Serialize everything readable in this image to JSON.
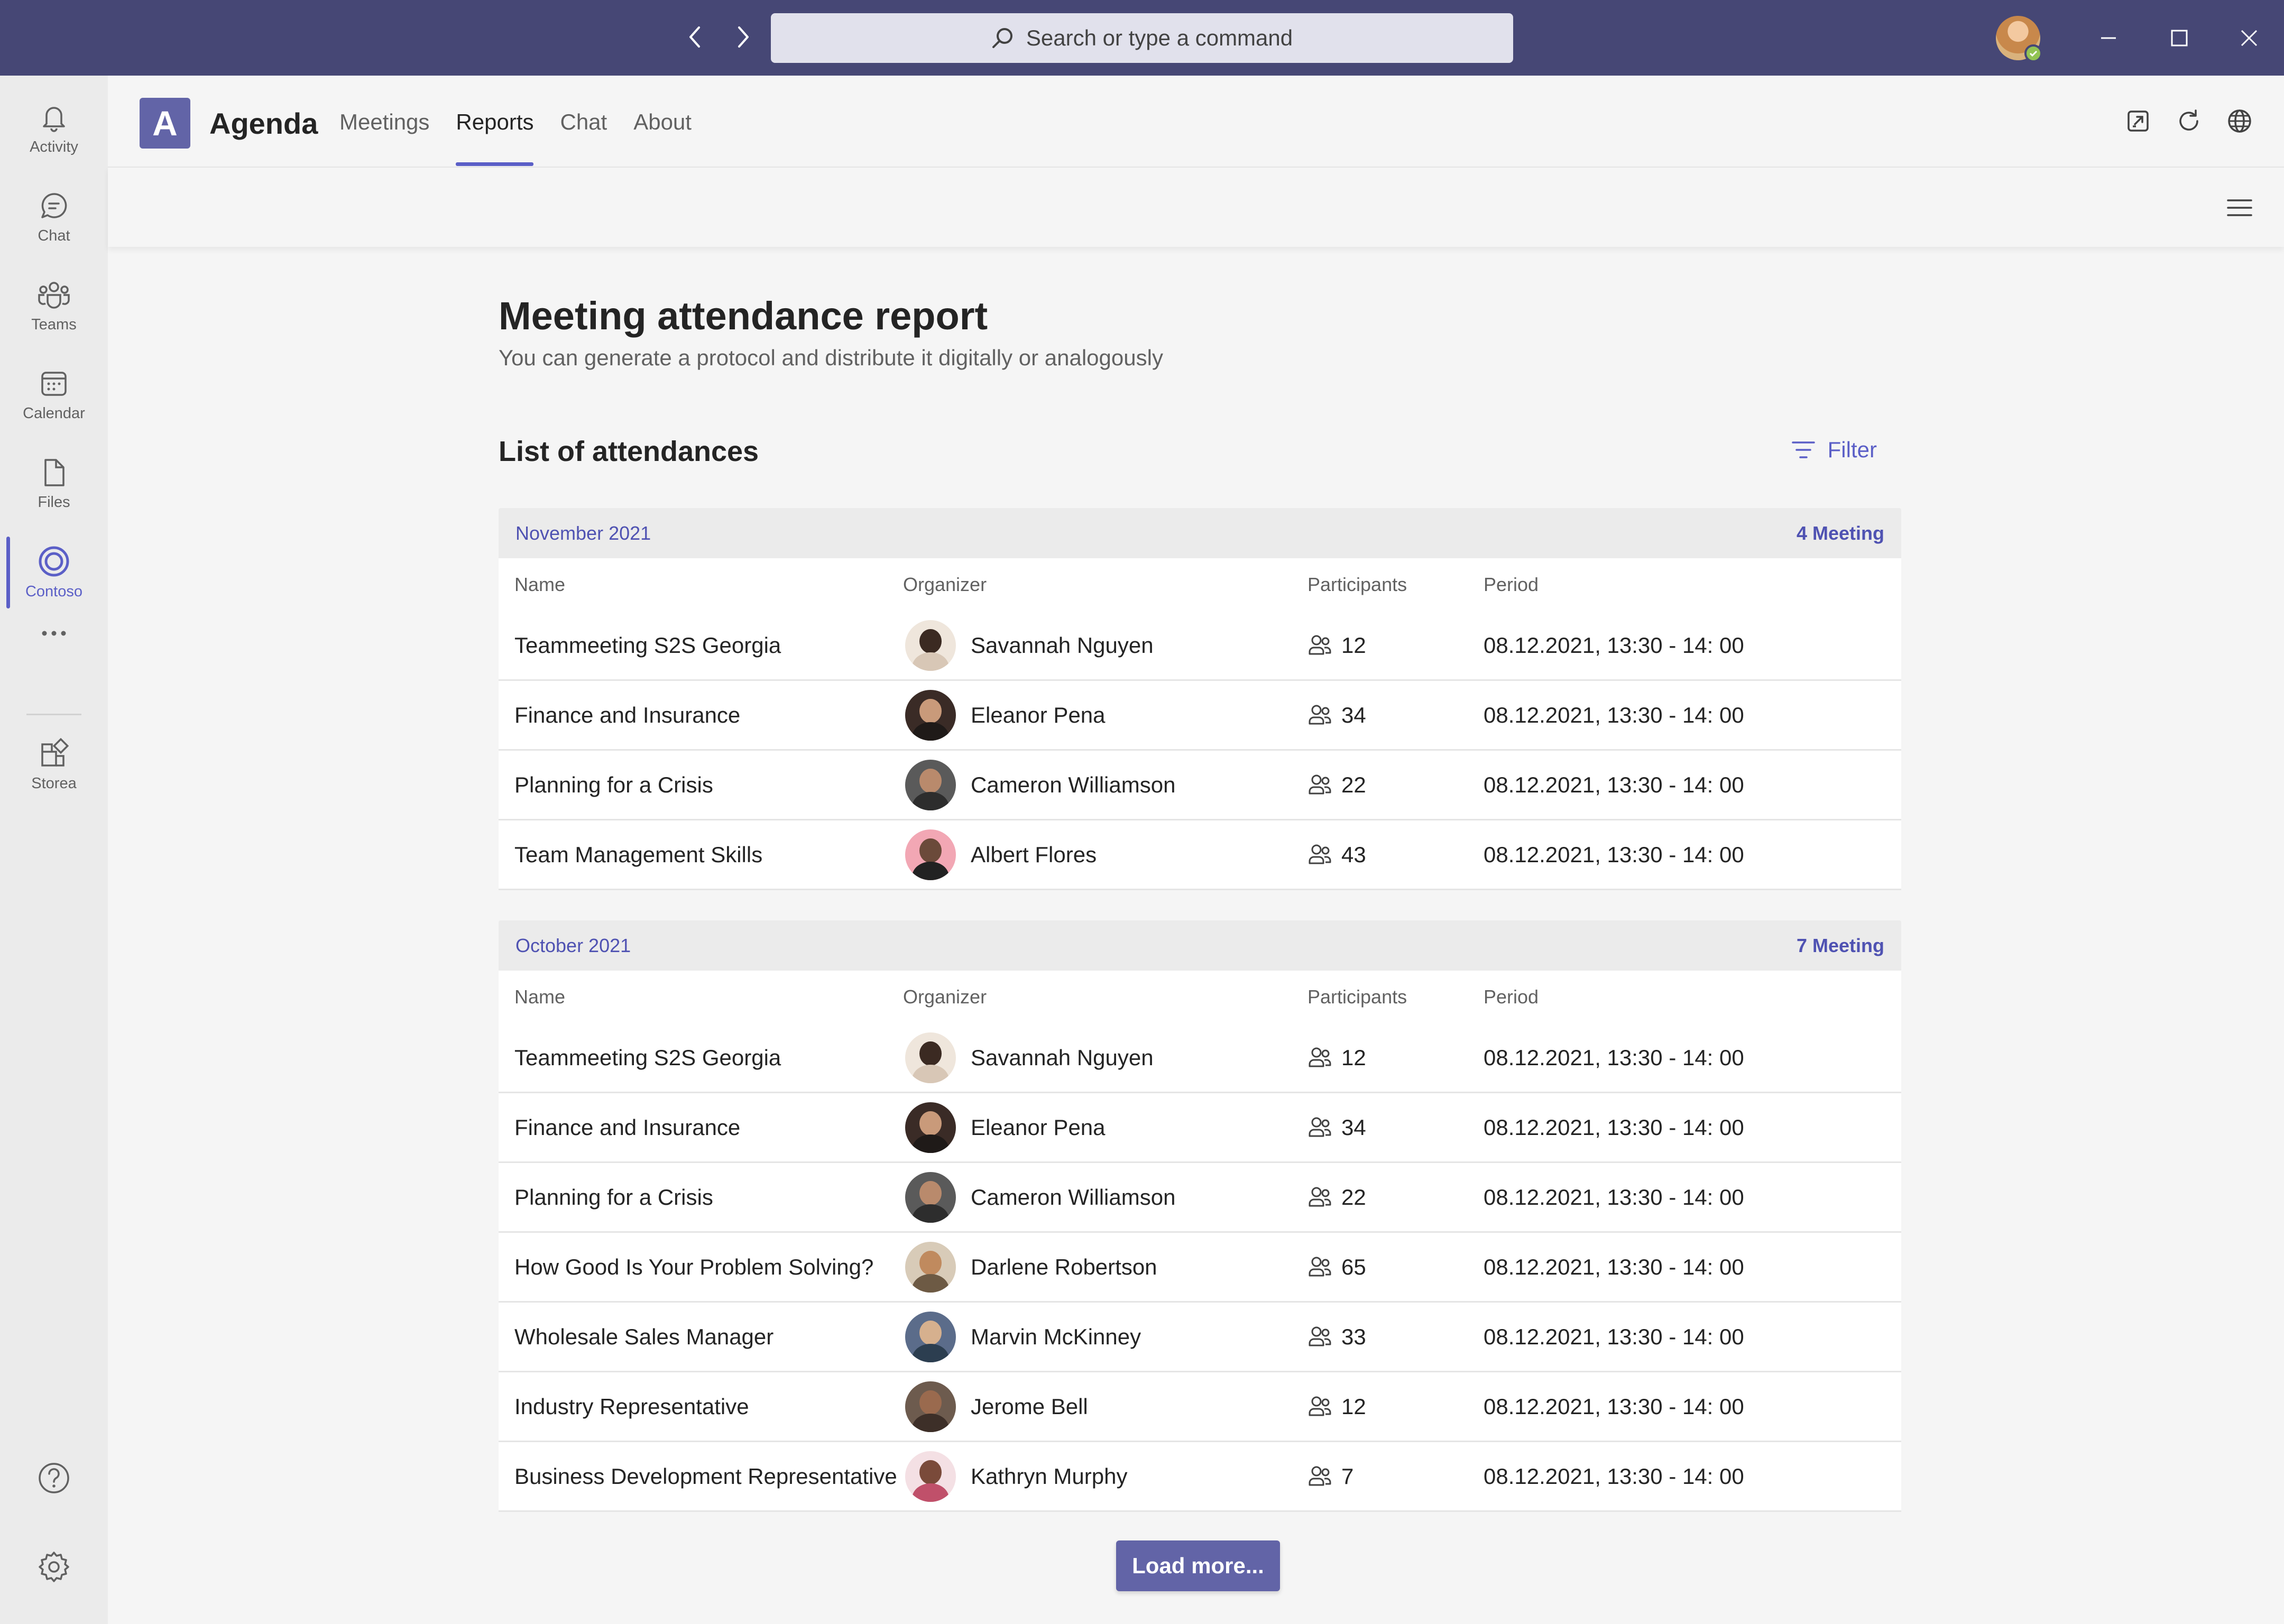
{
  "titlebar": {
    "search_placeholder": "Search or type a command",
    "icons": [
      "back-icon",
      "forward-icon",
      "search-icon",
      "minimize-icon",
      "maximize-icon",
      "close-icon"
    ]
  },
  "rail": {
    "items": [
      {
        "label": "Activity",
        "icon": "bell-icon"
      },
      {
        "label": "Chat",
        "icon": "chat-icon"
      },
      {
        "label": "Teams",
        "icon": "teams-icon"
      },
      {
        "label": "Calendar",
        "icon": "calendar-icon"
      },
      {
        "label": "Files",
        "icon": "file-icon"
      },
      {
        "label": "Contoso",
        "icon": "contoso-icon",
        "active": true
      },
      {
        "label": "Storea",
        "icon": "apps-icon"
      }
    ]
  },
  "app": {
    "logo_letter": "A",
    "name": "Agenda",
    "tabs": [
      {
        "label": "Meetings"
      },
      {
        "label": "Reports",
        "active": true
      },
      {
        "label": "Chat"
      },
      {
        "label": "About"
      }
    ]
  },
  "page": {
    "title": "Meeting attendance report",
    "subtitle": "You can generate a protocol and distribute it digitally or analogously",
    "list_title": "List of attendances",
    "filter_label": "Filter",
    "columns": {
      "name": "Name",
      "organizer": "Organizer",
      "participants": "Participants",
      "period": "Period"
    },
    "load_more": "Load more..."
  },
  "groups": [
    {
      "month": "November 2021",
      "count": "4 Meeting",
      "rows": [
        {
          "name": "Teammeeting S2S Georgia",
          "organizer": "Savannah Nguyen",
          "participants": "12",
          "period": "08.12.2021, 13:30 - 14: 00"
        },
        {
          "name": "Finance and Insurance",
          "organizer": "Eleanor Pena",
          "participants": "34",
          "period": "08.12.2021, 13:30 - 14: 00"
        },
        {
          "name": "Planning for a Crisis",
          "organizer": "Cameron Williamson",
          "participants": "22",
          "period": "08.12.2021, 13:30 - 14: 00"
        },
        {
          "name": "Team Management Skills",
          "organizer": "Albert Flores",
          "participants": "43",
          "period": "08.12.2021, 13:30 - 14: 00"
        }
      ]
    },
    {
      "month": "October 2021",
      "count": "7 Meeting",
      "rows": [
        {
          "name": "Teammeeting S2S Georgia",
          "organizer": "Savannah Nguyen",
          "participants": "12",
          "period": "08.12.2021, 13:30 - 14: 00"
        },
        {
          "name": "Finance and Insurance",
          "organizer": "Eleanor Pena",
          "participants": "34",
          "period": "08.12.2021, 13:30 - 14: 00"
        },
        {
          "name": "Planning for a Crisis",
          "organizer": "Cameron Williamson",
          "participants": "22",
          "period": "08.12.2021, 13:30 - 14: 00"
        },
        {
          "name": "How Good Is Your Problem Solving?",
          "organizer": "Darlene Robertson",
          "participants": "65",
          "period": "08.12.2021, 13:30 - 14: 00"
        },
        {
          "name": "Wholesale Sales Manager",
          "organizer": "Marvin McKinney",
          "participants": "33",
          "period": "08.12.2021, 13:30 - 14: 00"
        },
        {
          "name": "Industry Representative",
          "organizer": "Jerome Bell",
          "participants": "12",
          "period": "08.12.2021, 13:30 - 14: 00"
        },
        {
          "name": "Business Development Representative",
          "organizer": "Kathryn Murphy",
          "participants": "7",
          "period": "08.12.2021, 13:30 - 14: 00"
        }
      ]
    }
  ],
  "colors": {
    "accent": "#5b5fc7",
    "titlebar": "#464775",
    "button": "#6264a7"
  }
}
